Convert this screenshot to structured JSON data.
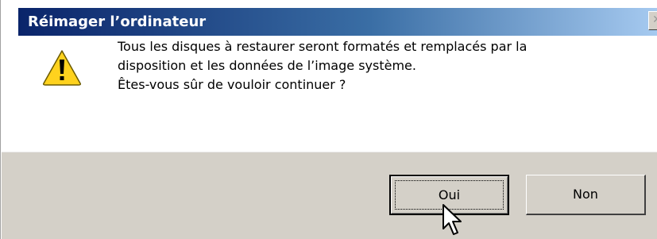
{
  "window": {
    "title": "Réimager l’ordinateur",
    "close_glyph": "✕"
  },
  "dialog": {
    "icon": "warning-icon",
    "message_lines": [
      "Tous les disques à restaurer seront formatés et remplacés par la",
      "disposition et les données de l’image système.",
      "Êtes-vous sûr de vouloir continuer ?"
    ]
  },
  "buttons": {
    "yes_label": "Oui",
    "no_label": "Non"
  },
  "colors": {
    "title_bar_start": "#0a246a",
    "title_bar_end": "#a6caf0",
    "face": "#d4d0c8",
    "warning_yellow": "#ffd21e"
  }
}
